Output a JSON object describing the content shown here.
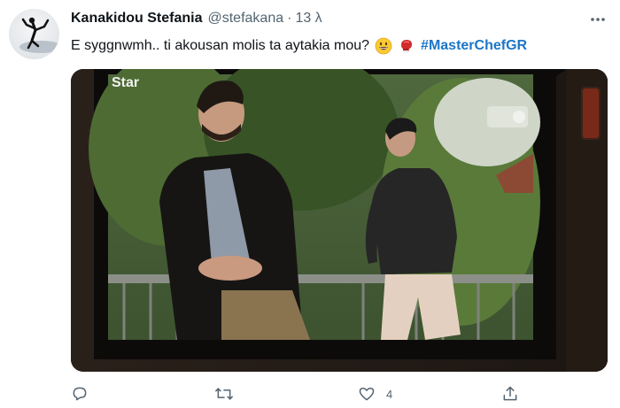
{
  "tweet": {
    "author_name": "Kanakidou Stefania",
    "handle": "@stefakana",
    "separator": "·",
    "time": "13 λ",
    "text": "E syggnwmh.. ti akousan molis ta aytakia mou?",
    "hashtag": "#MasterChefGR",
    "emojis": [
      "grinning-face-emoji",
      "boxing-glove-emoji"
    ],
    "media": {
      "channel_logo": "Star",
      "icons": [
        "tv-screen-photo"
      ]
    },
    "actions": {
      "reply_count": "",
      "retweet_count": "",
      "like_count": "4",
      "share_count": ""
    }
  },
  "colors": {
    "text_primary": "#0f1419",
    "text_secondary": "#536471",
    "hashtag": "#1b76c8",
    "icon": "#536471"
  }
}
